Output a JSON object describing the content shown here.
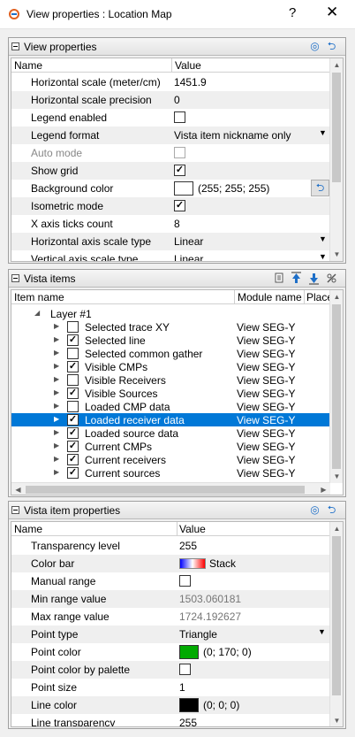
{
  "window": {
    "title": "View properties : Location Map",
    "help": "?",
    "close": "✕"
  },
  "view_properties": {
    "title": "View properties",
    "columns": [
      "Name",
      "Value"
    ],
    "rows": [
      {
        "name": "Horizontal scale (meter/cm)",
        "value": "1451.9"
      },
      {
        "name": "Horizontal scale precision",
        "value": "0"
      },
      {
        "name": "Legend enabled",
        "checked": false
      },
      {
        "name": "Legend format",
        "value": "Vista item nickname only"
      },
      {
        "name": "Auto mode",
        "checked": false,
        "disabled": true
      },
      {
        "name": "Show grid",
        "checked": true
      },
      {
        "name": "Background color",
        "value": "(255; 255; 255)",
        "color": "#ffffff"
      },
      {
        "name": "Isometric mode",
        "checked": true
      },
      {
        "name": "X axis ticks count",
        "value": "8"
      },
      {
        "name": "Horizontal axis scale type",
        "value": "Linear"
      },
      {
        "name": "Vertical axis scale type",
        "value": "Linear"
      }
    ]
  },
  "vista_items": {
    "title": "Vista items",
    "columns": [
      "Item name",
      "Module name",
      "Place"
    ],
    "layer": "Layer  #1",
    "items": [
      {
        "label": "Selected trace XY",
        "module": "View SEG-Y",
        "checked": false
      },
      {
        "label": "Selected line",
        "module": "View SEG-Y",
        "checked": true
      },
      {
        "label": "Selected common gather",
        "module": "View SEG-Y",
        "checked": false
      },
      {
        "label": "Visible CMPs",
        "module": "View SEG-Y",
        "checked": true
      },
      {
        "label": "Visible Receivers",
        "module": "View SEG-Y",
        "checked": false
      },
      {
        "label": "Visible Sources",
        "module": "View SEG-Y",
        "checked": true
      },
      {
        "label": "Loaded CMP data",
        "module": "View SEG-Y",
        "checked": false
      },
      {
        "label": "Loaded receiver data",
        "module": "View SEG-Y",
        "checked": true,
        "selected": true
      },
      {
        "label": "Loaded source data",
        "module": "View SEG-Y",
        "checked": true
      },
      {
        "label": "Current CMPs",
        "module": "View SEG-Y",
        "checked": true
      },
      {
        "label": "Current receivers",
        "module": "View SEG-Y",
        "checked": true
      },
      {
        "label": "Current sources",
        "module": "View SEG-Y",
        "checked": true
      }
    ]
  },
  "item_properties": {
    "title": "Vista item properties",
    "columns": [
      "Name",
      "Value"
    ],
    "rows": [
      {
        "name": "Transparency level",
        "value": "255"
      },
      {
        "name": "Color bar",
        "value": "Stack"
      },
      {
        "name": "Manual range",
        "checked": false
      },
      {
        "name": "Min range value",
        "value": "1503.060181",
        "dim": true
      },
      {
        "name": "Max range value",
        "value": "1724.192627",
        "dim": true
      },
      {
        "name": "Point type",
        "value": "Triangle"
      },
      {
        "name": "Point color",
        "value": "(0; 170; 0)",
        "color": "#00aa00"
      },
      {
        "name": "Point color by palette",
        "checked": false
      },
      {
        "name": "Point size",
        "value": "1"
      },
      {
        "name": "Line color",
        "value": "(0; 0; 0)",
        "color": "#000000"
      },
      {
        "name": "Line transparency",
        "value": "255"
      }
    ]
  },
  "icons": {
    "app": "app-logo-icon",
    "target": "target-icon",
    "reset": "reset-icon"
  },
  "glyphs": {
    "check": "✓",
    "dropdown": "▼",
    "expand": "▶",
    "collapse": "◢",
    "up": "▲",
    "down": "▼",
    "left": "◀",
    "right": "▶",
    "reset": "⮌",
    "target": "◎"
  }
}
